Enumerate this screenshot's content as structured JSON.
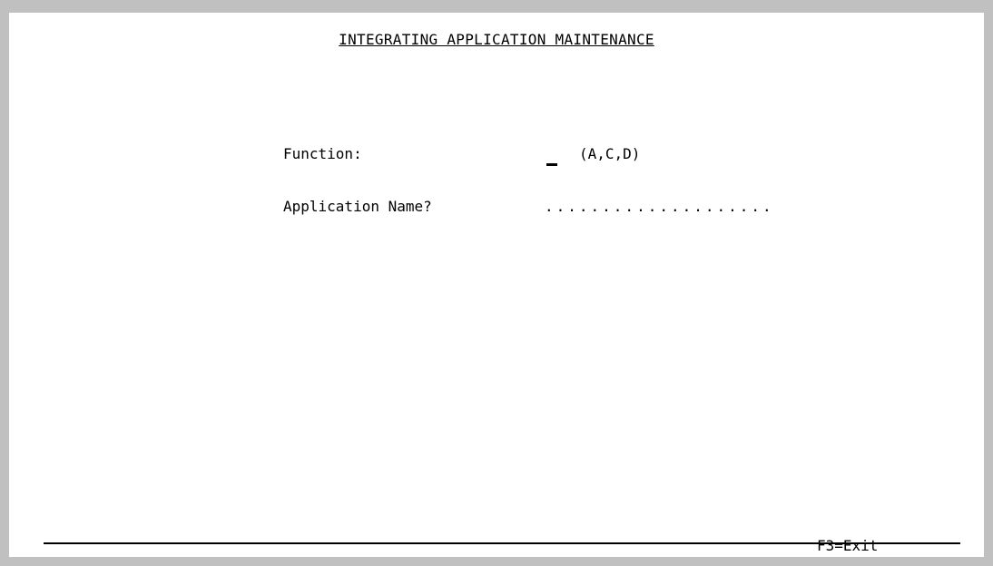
{
  "screen": {
    "title": "INTEGRATING APPLICATION MAINTENANCE",
    "function_label": "Function:",
    "function_value": "",
    "function_hint": "(A,C,D)",
    "application_label": "Application Name?",
    "application_value": "",
    "application_placeholder": "....................",
    "fkey_exit": "F3=Exit"
  },
  "colors": {
    "background": "#c0c0c0",
    "screen": "#ffffff",
    "text": "#000000"
  }
}
